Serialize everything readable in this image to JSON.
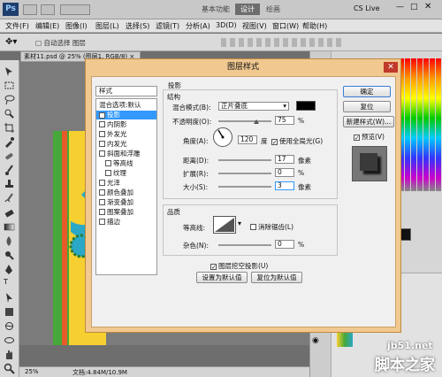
{
  "app": {
    "logo": "Ps",
    "workspace_buttons": [
      "基本功能",
      "设计",
      "绘画"
    ],
    "cs_live": "CS Live",
    "menus": [
      "文件(F)",
      "编辑(E)",
      "图像(I)",
      "图层(L)",
      "选择(S)",
      "滤镜(T)",
      "分析(A)",
      "3D(D)",
      "视图(V)",
      "窗口(W)",
      "帮助(H)"
    ],
    "options_hint": "□ 自动选择  图层",
    "doc_tab": "素材11.psd @ 25% (图层1, RGB/8) ×",
    "zoom": "25%",
    "doc_info": "文档:4.84M/10.9M"
  },
  "dialog": {
    "title": "图层样式",
    "close": "✕",
    "styles_header": "样式",
    "styles": [
      {
        "label": "混合选项:默认",
        "checkbox": false,
        "selected": false
      },
      {
        "label": "投影",
        "checkbox": true,
        "checked": true,
        "selected": true
      },
      {
        "label": "内阴影",
        "checkbox": true,
        "checked": false
      },
      {
        "label": "外发光",
        "checkbox": true,
        "checked": false
      },
      {
        "label": "内发光",
        "checkbox": true,
        "checked": false
      },
      {
        "label": "斜面和浮雕",
        "checkbox": true,
        "checked": false
      },
      {
        "label": "等高线",
        "checkbox": true,
        "checked": false,
        "indent": true
      },
      {
        "label": "纹理",
        "checkbox": true,
        "checked": false,
        "indent": true
      },
      {
        "label": "光泽",
        "checkbox": true,
        "checked": false
      },
      {
        "label": "颜色叠加",
        "checkbox": true,
        "checked": false
      },
      {
        "label": "渐变叠加",
        "checkbox": true,
        "checked": false
      },
      {
        "label": "图案叠加",
        "checkbox": true,
        "checked": false
      },
      {
        "label": "描边",
        "checkbox": true,
        "checked": false
      }
    ],
    "section_title": "投影",
    "structure": {
      "title": "结构",
      "blend_mode_label": "混合模式(B):",
      "blend_mode_value": "正片叠底",
      "opacity_label": "不透明度(O):",
      "opacity_value": "75",
      "opacity_unit": "%",
      "angle_label": "角度(A):",
      "angle_value": "120",
      "angle_unit": "度",
      "global_light_label": "使用全局光(G)",
      "global_light_checked": true,
      "distance_label": "距离(D):",
      "distance_value": "17",
      "distance_unit": "像素",
      "spread_label": "扩展(R):",
      "spread_value": "0",
      "spread_unit": "%",
      "size_label": "大小(S):",
      "size_value": "3",
      "size_unit": "像素"
    },
    "quality": {
      "title": "品质",
      "contour_label": "等高线:",
      "antialias_label": "消除锯齿(L)",
      "antialias_checked": false,
      "noise_label": "杂色(N):",
      "noise_value": "0",
      "noise_unit": "%"
    },
    "knockout_label": "图层挖空投影(U)",
    "knockout_checked": true,
    "set_default_label": "设置为默认值",
    "reset_default_label": "复位为默认值",
    "buttons": {
      "ok": "确定",
      "reset": "复位",
      "new_style": "新建样式(W)...",
      "preview_label": "预览(V)",
      "preview_checked": true
    }
  },
  "watermark": {
    "site": "jb51.net",
    "brand": "脚本之家"
  },
  "colors": {
    "dialog_frame": "#f0c890",
    "selected_item": "#3399ff",
    "close_button": "#c0392b"
  }
}
